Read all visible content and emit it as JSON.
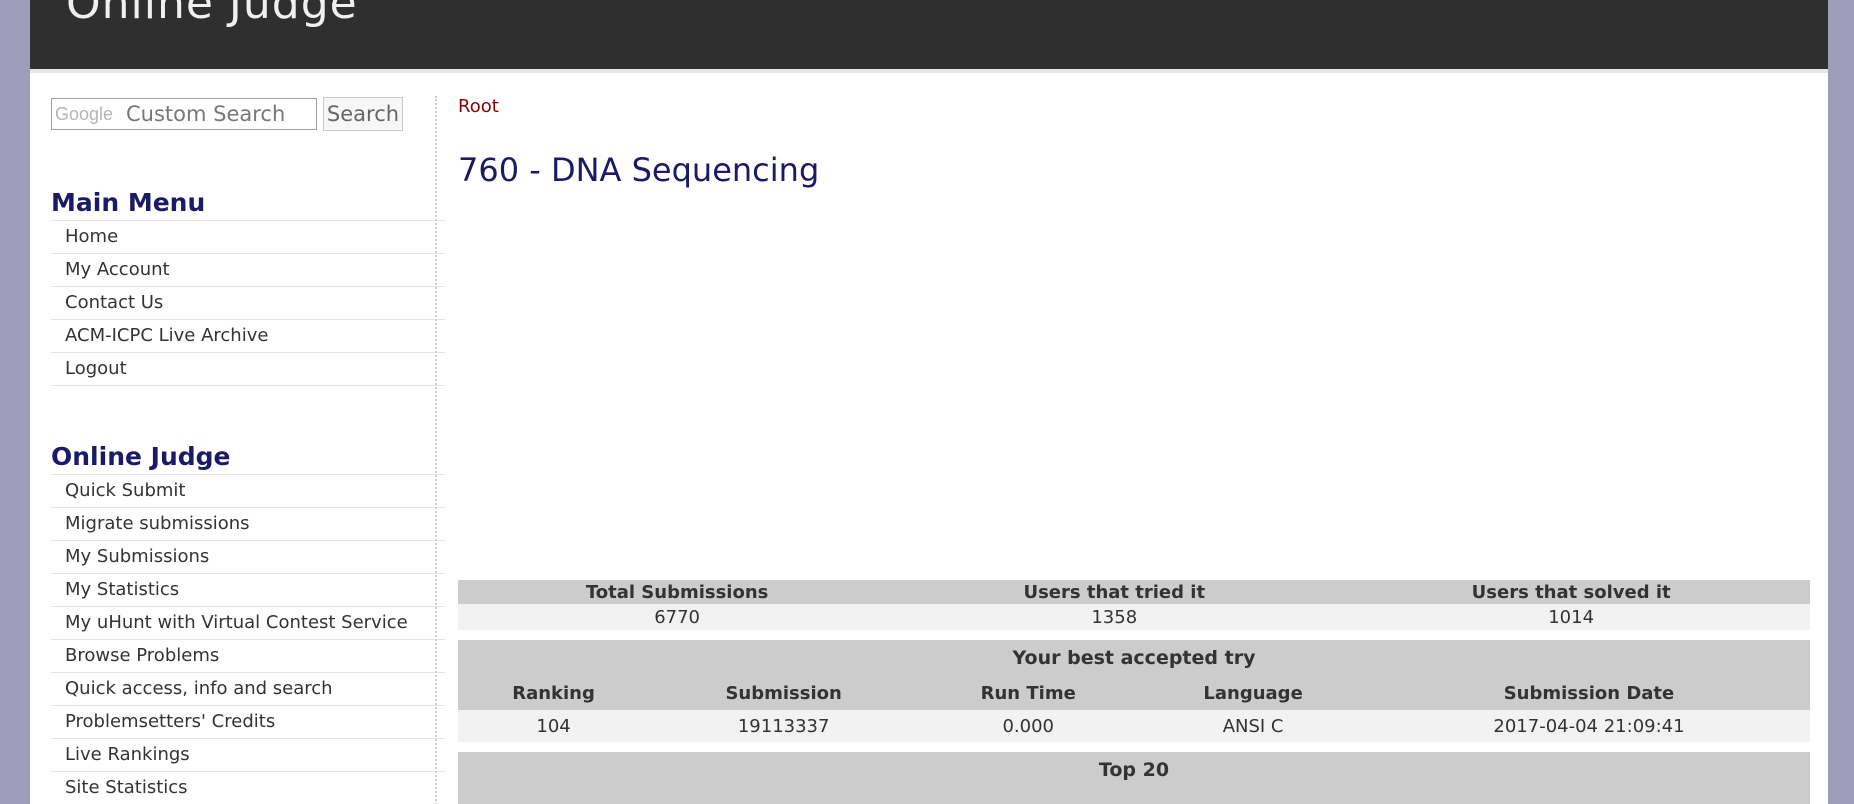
{
  "header": {
    "logo_text": "Online Judge"
  },
  "search": {
    "placeholder": "Custom Search",
    "google_mark": "Google",
    "button_label": "Search"
  },
  "main_menu": {
    "title": "Main Menu",
    "items": [
      "Home",
      "My Account",
      "Contact Us",
      "ACM-ICPC Live Archive",
      "Logout"
    ]
  },
  "online_judge_menu": {
    "title": "Online Judge",
    "items": [
      "Quick Submit",
      "Migrate submissions",
      "My Submissions",
      "My Statistics",
      "My uHunt with Virtual Contest Service",
      "Browse Problems",
      "Quick access, info and search",
      "Problemsetters' Credits",
      "Live Rankings",
      "Site Statistics"
    ]
  },
  "breadcrumb": "Root",
  "problem": {
    "title": "760 - DNA Sequencing"
  },
  "summary": {
    "headers": [
      "Total Submissions",
      "Users that tried it",
      "Users that solved it"
    ],
    "values": [
      "6770",
      "1358",
      "1014"
    ]
  },
  "best_try": {
    "title": "Your best accepted try",
    "headers": [
      "Ranking",
      "Submission",
      "Run Time",
      "Language",
      "Submission Date"
    ],
    "values": [
      "104",
      "19113337",
      "0.000",
      "ANSI C",
      "2017-04-04 21:09:41"
    ]
  },
  "top20": {
    "title": "Top 20"
  },
  "colors": {
    "header_bg": "#2f2f2f",
    "title_blue": "#1a1a66",
    "breadcrumb_red": "#8b0000",
    "table_header": "#cccccc",
    "table_row": "#f2f2f2",
    "outer_bg": "#9e9ebb"
  }
}
